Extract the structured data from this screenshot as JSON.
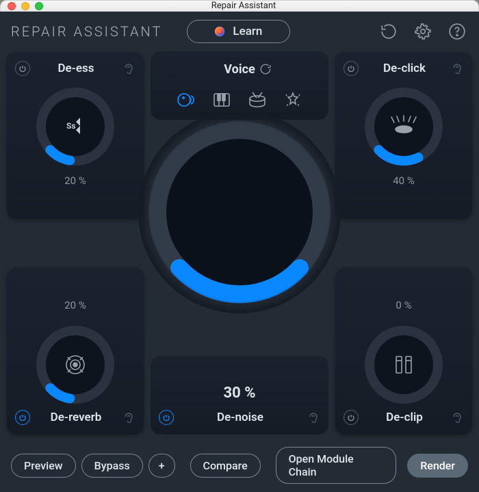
{
  "window": {
    "title": "Repair Assistant"
  },
  "toolbar": {
    "app_name": "REPAIR ASSISTANT",
    "learn_label": "Learn"
  },
  "voice": {
    "title": "Voice",
    "selected": "voice"
  },
  "modules": {
    "deess": {
      "title": "De-ess",
      "pct": "20 %",
      "value": 20
    },
    "declick": {
      "title": "De-click",
      "pct": "40 %",
      "value": 40
    },
    "dereverb": {
      "title": "De-reverb",
      "pct": "20 %",
      "value": 20
    },
    "declip": {
      "title": "De-clip",
      "pct": "0 %",
      "value": 0
    },
    "denoise": {
      "title": "De-noise",
      "pct": "30 %",
      "value": 30
    }
  },
  "footer": {
    "preview": "Preview",
    "bypass": "Bypass",
    "plus": "+",
    "compare": "Compare",
    "open_chain": "Open Module Chain",
    "render": "Render"
  }
}
